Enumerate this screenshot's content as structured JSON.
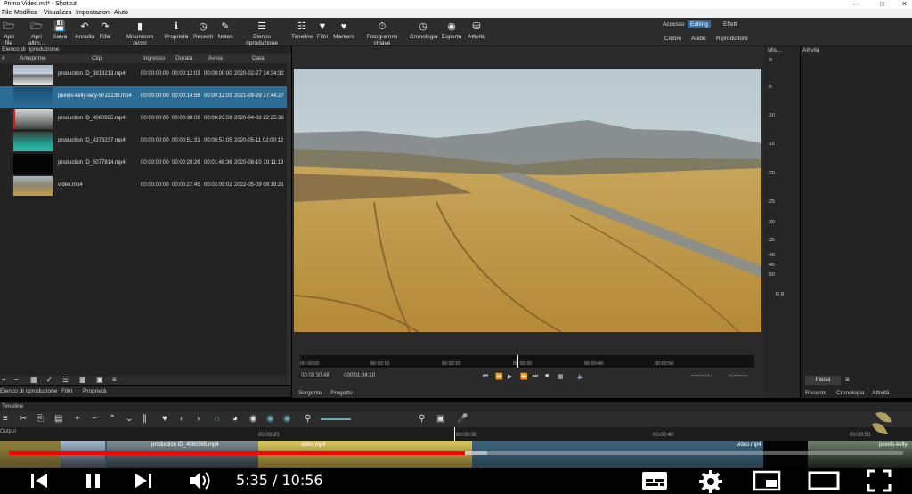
{
  "titlebar": {
    "title": "Primo Video.mlt* - Shotcut"
  },
  "menu": [
    "File",
    "Modifica",
    "Visualizza",
    "Impostazioni",
    "Aiuto"
  ],
  "toolbar": {
    "buttons": [
      "Apri file",
      "Apri altro...",
      "Salva",
      "Annulla",
      "Rifai",
      "Misuratore picco",
      "Proprietà",
      "Recenti",
      "Notes",
      "Elenco riproduzione",
      "Timeline",
      "Filtri",
      "Markers",
      "Fotogrammi chiave",
      "Cronologia",
      "Esporta",
      "Attività"
    ],
    "layouts": [
      "Accesso",
      "Editing",
      "Effetti",
      "Colore",
      "Audio",
      "Riproduttore"
    ],
    "active_layout": "Editing"
  },
  "playlist": {
    "title": "Elenco di riproduzione",
    "columns": [
      "#",
      "Anteprime",
      "Clip",
      "Ingresso",
      "Durata",
      "Avvia",
      "Data"
    ],
    "rows": [
      {
        "clip": "production ID_3818213.mp4",
        "in": "00:00:00:00",
        "dur": "00:00:12:03",
        "start": "00:00:00:00",
        "date": "2020-02-27 14:34:32"
      },
      {
        "clip": "pexels-kelly-lacy-9722139.mp4",
        "in": "00:00:00:00",
        "dur": "00:00:14:56",
        "start": "00:00:12:03",
        "date": "2021-09-29 17:44:27"
      },
      {
        "clip": "production ID_4060985.mp4",
        "in": "00:00:00:00",
        "dur": "00:00:30:06",
        "start": "00:00:26:59",
        "date": "2020-04-02 22:25:36"
      },
      {
        "clip": "production ID_4373237.mp4",
        "in": "00:00:00:00",
        "dur": "00:00:51:31",
        "start": "00:00:57:05",
        "date": "2020-05-11 02:00:12"
      },
      {
        "clip": "production ID_5077814.mp4",
        "in": "00:00:00:00",
        "dur": "00:00:20:26",
        "start": "00:01:48:36",
        "date": "2020-08-10 19:11:19"
      },
      {
        "clip": "video.mp4",
        "in": "00:00:00:00",
        "dur": "00:00:27:45",
        "start": "00:02:09:02",
        "date": "2022-05-09 09:18:21"
      }
    ],
    "selected_index": 1,
    "tabs": [
      "Elenco di riproduzione",
      "Filtri",
      "Proprietà"
    ]
  },
  "viewer": {
    "ruler": [
      "00:00:00",
      "00:00:10",
      "00:00:20",
      "00:00:30",
      "00:00:40",
      "00:00:50"
    ],
    "position": "00:00:30:48",
    "duration": "/ 00:01:04:10",
    "in_out": "--:--:--:-- /",
    "in_out2": "--:--:--:--",
    "tabs": [
      "Sorgente",
      "Progetto"
    ]
  },
  "meter": {
    "title": "Mis...",
    "ticks": [
      "0",
      "-5",
      "-10",
      "-15",
      "-20",
      "-25",
      "-30",
      "-35",
      "-40",
      "-45",
      "-50"
    ],
    "channels": "R  R"
  },
  "jobs": {
    "title": "Attività",
    "pause": "Pausa",
    "tabs": [
      "Recente",
      "Cronologia",
      "Attività"
    ]
  },
  "timeline": {
    "title": "Timeline",
    "output_label": "Output",
    "ruler": [
      "00:00:20",
      "00:00:30",
      "00:00:40",
      "00:00:50"
    ],
    "clips": [
      "production ID_4060985.mp4",
      "video.mp4",
      "video.mp4",
      "pexels-kelly-"
    ]
  },
  "player": {
    "time": "5:35 / 10:56",
    "played_fraction": 0.51,
    "buffered_fraction": 0.535
  }
}
